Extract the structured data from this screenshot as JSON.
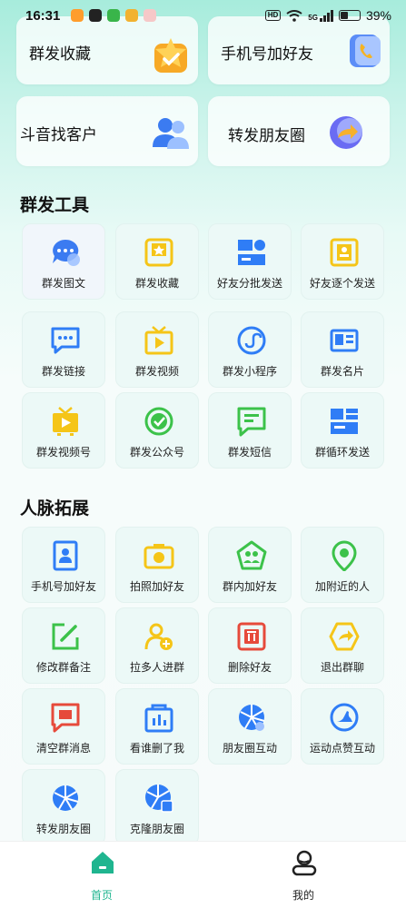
{
  "status_bar": {
    "time": "16:31",
    "hd": "HD",
    "signal": "5G",
    "battery": "39%",
    "battery_level": 0.39
  },
  "top_cards": [
    {
      "label": "群发收藏",
      "icon": "star-folder-icon"
    },
    {
      "label": "手机号加好友",
      "icon": "phone-book-icon"
    },
    {
      "label": "斗音找客户",
      "icon": "users-icon"
    },
    {
      "label": "转发朋友圈",
      "icon": "share-circle-icon"
    }
  ],
  "sections": [
    {
      "title": "群发工具",
      "tiles": [
        {
          "label": "群发图文",
          "icon": "chat-bubble-icon"
        },
        {
          "label": "群发收藏",
          "icon": "star-box-icon"
        },
        {
          "label": "好友分批发送",
          "icon": "batch-send-icon"
        },
        {
          "label": "好友逐个发送",
          "icon": "contact-card-icon"
        },
        {
          "label": "群发链接",
          "icon": "message-dots-icon"
        },
        {
          "label": "群发视频",
          "icon": "tv-play-icon"
        },
        {
          "label": "群发小程序",
          "icon": "mini-program-icon"
        },
        {
          "label": "群发名片",
          "icon": "business-card-icon"
        },
        {
          "label": "群发视频号",
          "icon": "video-channel-icon"
        },
        {
          "label": "群发公众号",
          "icon": "official-account-icon"
        },
        {
          "label": "群发短信",
          "icon": "sms-icon"
        },
        {
          "label": "群循环发送",
          "icon": "loop-send-icon"
        }
      ]
    },
    {
      "title": "人脉拓展",
      "tiles": [
        {
          "label": "手机号加好友",
          "icon": "phone-contact-icon"
        },
        {
          "label": "拍照加好友",
          "icon": "camera-icon"
        },
        {
          "label": "群内加好友",
          "icon": "group-add-icon"
        },
        {
          "label": "加附近的人",
          "icon": "location-pin-icon"
        },
        {
          "label": "修改群备注",
          "icon": "edit-icon"
        },
        {
          "label": "拉多人进群",
          "icon": "add-members-icon"
        },
        {
          "label": "删除好友",
          "icon": "delete-icon"
        },
        {
          "label": "退出群聊",
          "icon": "exit-group-icon"
        },
        {
          "label": "清空群消息",
          "icon": "clear-messages-icon"
        },
        {
          "label": "看谁删了我",
          "icon": "check-deleted-icon"
        },
        {
          "label": "朋友圈互动",
          "icon": "moments-interact-icon"
        },
        {
          "label": "运动点赞互动",
          "icon": "sports-like-icon"
        },
        {
          "label": "转发朋友圈",
          "icon": "forward-moments-icon"
        },
        {
          "label": "克隆朋友圈",
          "icon": "clone-moments-icon"
        }
      ]
    }
  ],
  "bottom_nav": [
    {
      "label": "首页",
      "icon": "home-icon",
      "active": true
    },
    {
      "label": "我的",
      "icon": "profile-icon",
      "active": false
    }
  ],
  "colors": {
    "accent": "#1fb58f",
    "blue": "#2f7df6",
    "yellow": "#f5c518",
    "green": "#3cc24a",
    "red": "#e64a3b"
  }
}
